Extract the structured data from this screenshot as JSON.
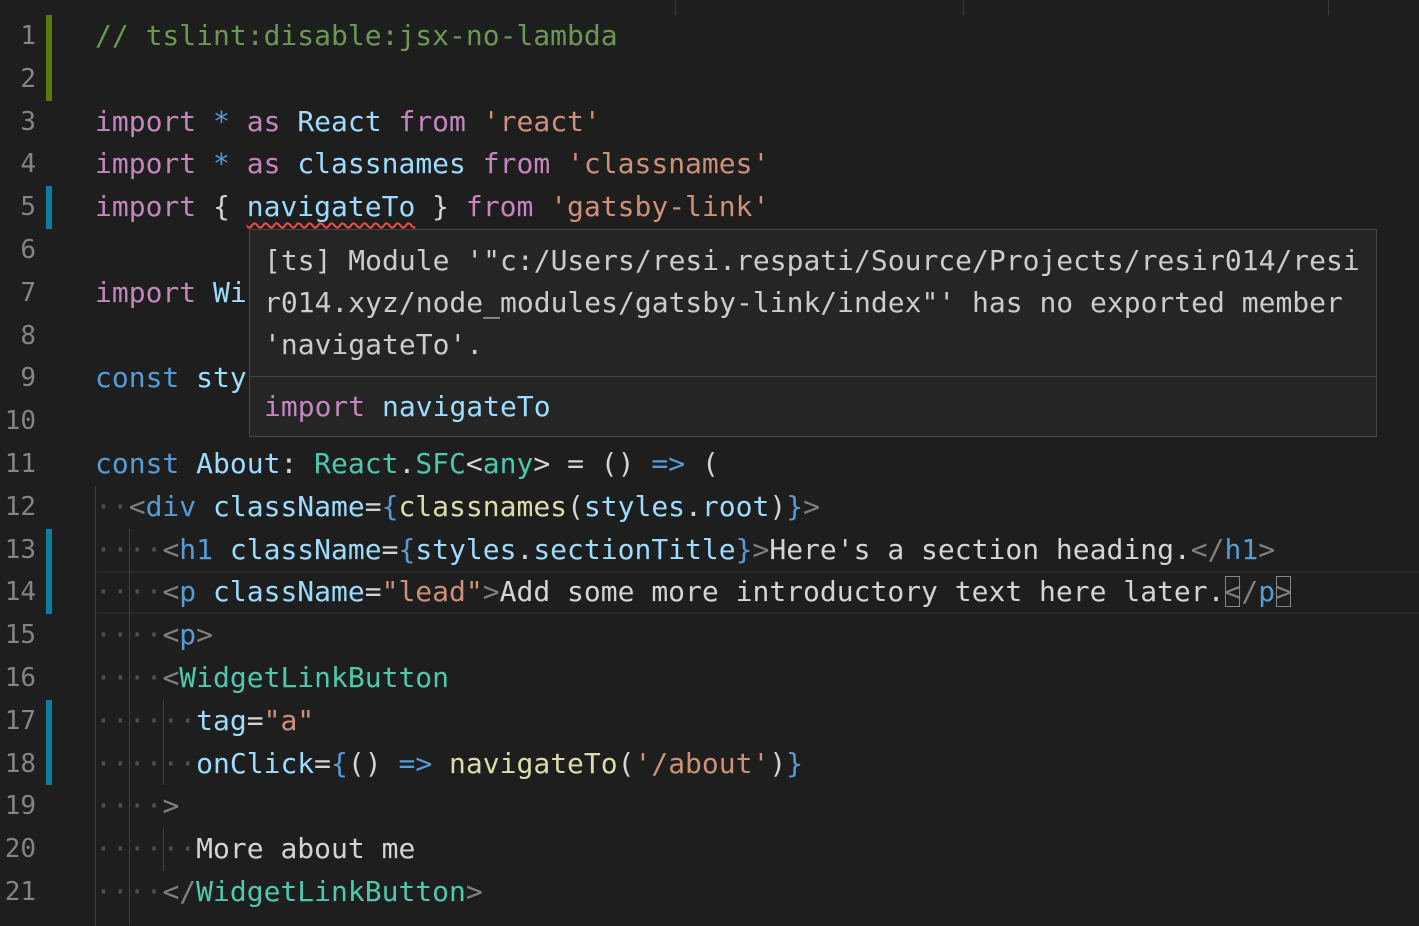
{
  "editor": {
    "line_numbers": [
      "1",
      "2",
      "3",
      "4",
      "5",
      "6",
      "7",
      "8",
      "9",
      "10",
      "11",
      "12",
      "13",
      "14",
      "15",
      "16",
      "17",
      "18",
      "19",
      "20",
      "21"
    ],
    "tokens": {
      "l1_comment": "// tslint:disable:jsx-no-lambda",
      "import": "import",
      "star": "*",
      "as": "as",
      "react_ns": "React",
      "from": "from",
      "react_str": "'react'",
      "classnames_ns": "classnames",
      "classnames_str": "'classnames'",
      "brace_open": "{",
      "brace_close": "}",
      "navigateTo": "navigateTo",
      "gatsby_str": "'gatsby-link'",
      "l7_partial": "Wi",
      "const": "const",
      "l9_partial": "sty",
      "about": "About",
      "colon": ":",
      "react_type": "React",
      "dot": ".",
      "sfc": "SFC",
      "lt": "<",
      "gt": ">",
      "any": "any",
      "eq": "=",
      "parens": "()",
      "arrow": "=>",
      "paren_open": "(",
      "paren_close": ")",
      "div": "div",
      "className": "className",
      "classnames_call": "classnames",
      "styles": "styles",
      "root": "root",
      "h1": "h1",
      "sectionTitle": "sectionTitle",
      "h1_text": "Here's a section heading.",
      "close_lt": "</",
      "p": "p",
      "p_open_tag": "p",
      "lead_str": "\"lead\"",
      "p_text": "Add some more introductory text here later.",
      "close_slash": "/",
      "widget": "WidgetLinkButton",
      "tag_attr": "tag",
      "tag_val": "\"a\"",
      "onClick": "onClick",
      "about_str": "'/about'",
      "more_text": "More about me"
    }
  },
  "hover": {
    "message": "[ts] Module '\"c:/Users/resi.respati/Source/Projects/resir014/resir014.xyz/node_modules/gatsby-link/index\"' has no exported member 'navigateTo'.",
    "code_keyword": "import",
    "code_symbol": "navigateTo"
  },
  "colors": {
    "background": "#1e1e1e",
    "git_added": "#587c0c",
    "git_modified": "#0c7d9d",
    "error_squiggle": "#f14c4c"
  }
}
